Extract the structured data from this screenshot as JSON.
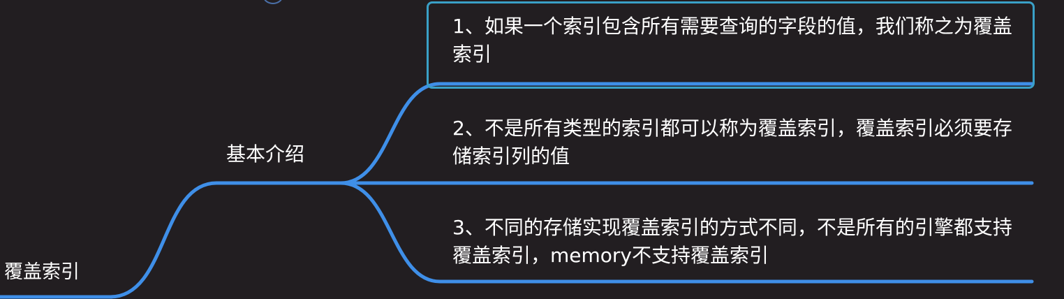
{
  "colors": {
    "background": "#221e21",
    "branch": "#3f8fe8",
    "selection": "#3aa0c7",
    "text": "#ffffff"
  },
  "mindmap": {
    "root": {
      "label": "覆盖索引"
    },
    "branch": {
      "label": "基本介绍"
    },
    "leaves": [
      {
        "label": "1、如果一个索引包含所有需要查询的字段的值，我们称之为覆盖索引",
        "selected": true
      },
      {
        "label": "2、不是所有类型的索引都可以称为覆盖索引，覆盖索引必须要存储索引列的值",
        "selected": false
      },
      {
        "label": "3、不同的存储实现覆盖索引的方式不同，不是所有的引擎都支持覆盖索引，memory不支持覆盖索引",
        "selected": false
      }
    ]
  }
}
